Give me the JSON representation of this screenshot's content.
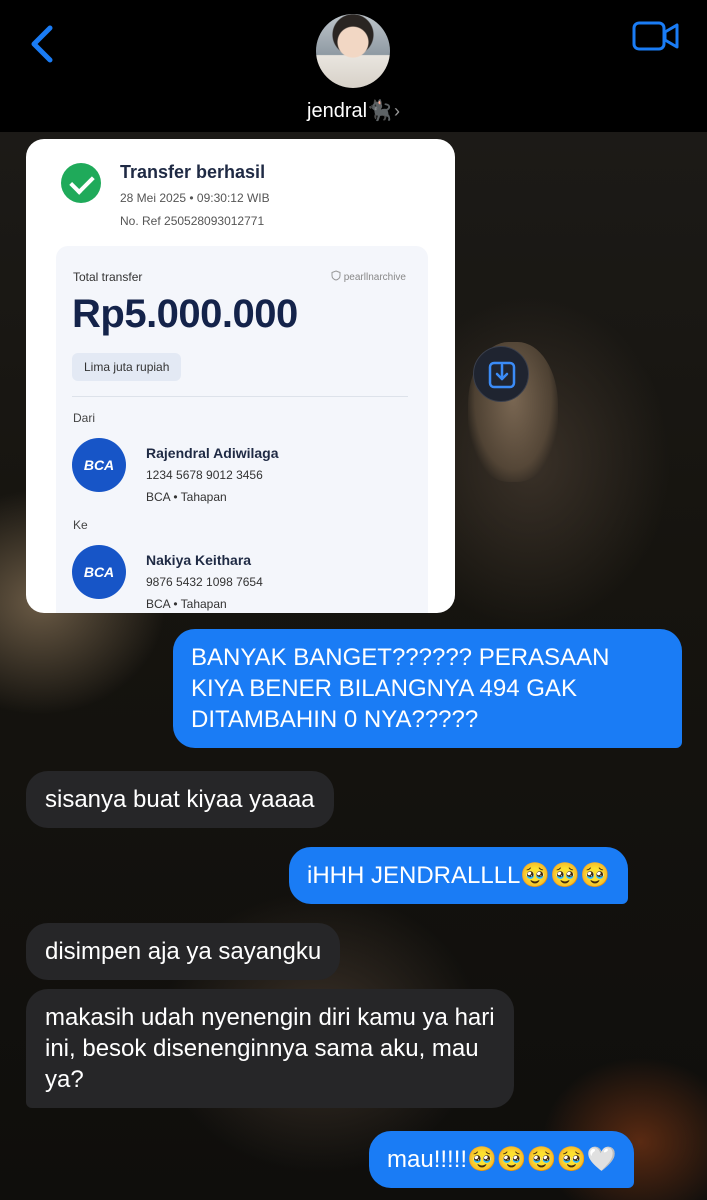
{
  "header": {
    "back_icon": "chevron-left-icon",
    "contact_name": "jendral🐈‍⬛",
    "chevron": "›",
    "video_icon": "video-call-icon",
    "accent_color": "#1a7cf5"
  },
  "receipt": {
    "title": "Transfer berhasil",
    "datetime": "28 Mei 2025 • 09:30:12 WIB",
    "reference": "No. Ref 250528093012771",
    "total_label": "Total transfer",
    "watermark": "pearllnarchive",
    "amount": "Rp5.000.000",
    "amount_words": "Lima juta rupiah",
    "from_label": "Dari",
    "from": {
      "bank": "BCA",
      "name": "Rajendral Adiwilaga",
      "account": "1234 5678 9012 3456",
      "type": "BCA • Tahapan"
    },
    "to_label": "Ke",
    "to": {
      "bank": "BCA",
      "name": "Nakiya Keithara",
      "account": "9876 5432 1098 7654",
      "type": "BCA • Tahapan"
    },
    "success_color": "#1faa5a"
  },
  "messages": [
    {
      "from": "me",
      "text": "BANYAK BANGET?????? PERASAAN KIYA BENER BILANGNYA 494 GAK DITAMBAHIN 0 NYA?????"
    },
    {
      "from": "them",
      "text": "sisanya buat kiyaa yaaaa"
    },
    {
      "from": "me",
      "text": "iHHH JENDRALLLL🥹🥹🥹"
    },
    {
      "from": "them",
      "text": "disimpen aja ya sayangku"
    },
    {
      "from": "them",
      "text": "makasih udah nyenengin diri kamu ya hari ini, besok disenenginnya sama aku, mau ya?"
    },
    {
      "from": "me",
      "text": "mau!!!!!🥹🥹🥹🥹🤍"
    }
  ]
}
